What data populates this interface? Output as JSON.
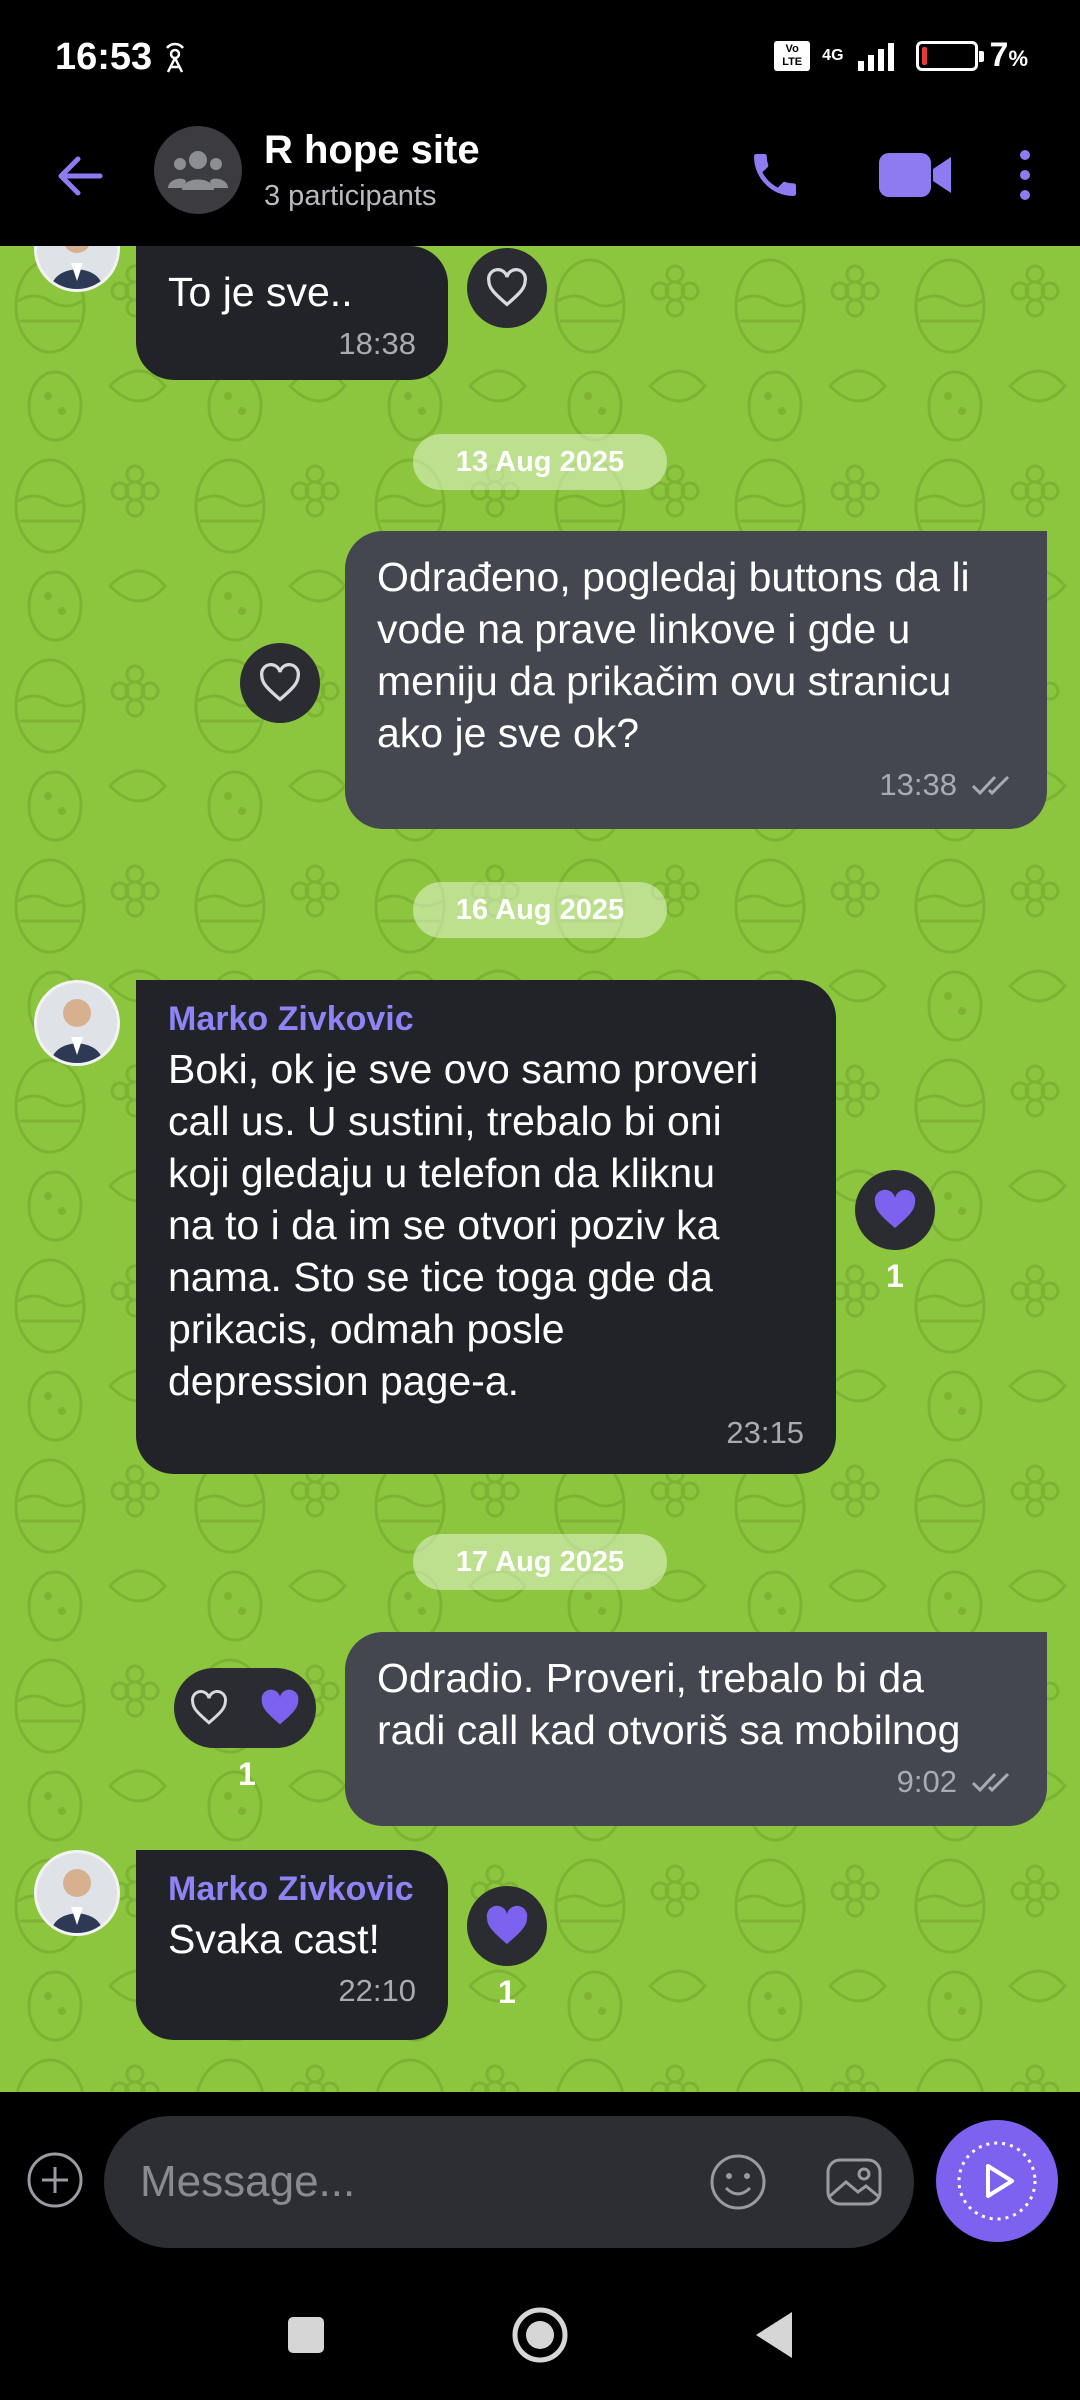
{
  "status_bar": {
    "time": "16:53",
    "volte": "Vo LTE",
    "network": "4G",
    "battery_percent": "7",
    "battery_unit": "%"
  },
  "header": {
    "title": "R hope site",
    "subtitle": "3 participants"
  },
  "colors": {
    "chat_background": "#8cc63e",
    "accent": "#7d62f0",
    "incoming_bubble": "#222328",
    "outgoing_bubble": "#444750"
  },
  "messages": [
    {
      "type": "in",
      "text": "To je sve..",
      "time": "18:38",
      "reaction": "heart-outline"
    },
    {
      "type": "date",
      "label": "13 Aug 2025"
    },
    {
      "type": "out",
      "text": "Odrađeno, pogledaj buttons da li\nvode na prave linkove i gde u\nmeniju da prikačim ovu stranicu\nako je sve ok?",
      "time": "13:38",
      "status": "read",
      "reaction": "heart-outline"
    },
    {
      "type": "date",
      "label": "16 Aug 2025"
    },
    {
      "type": "in",
      "sender": "Marko Zivkovic",
      "text": "Boki, ok je sve ovo samo proveri\ncall us. U sustini, trebalo bi oni\nkoji gledaju u telefon da kliknu\nna to i da im se otvori poziv ka\nnama. Sto se tice toga gde da\nprikacis, odmah posle\ndepression page-a.",
      "time": "23:15",
      "reaction": "heart-filled",
      "reaction_count": "1"
    },
    {
      "type": "date",
      "label": "17 Aug 2025"
    },
    {
      "type": "out",
      "text": "Odradio. Proveri, trebalo bi da\nradi call kad otvoriš sa mobilnog",
      "time": "9:02",
      "status": "read",
      "reaction": "heart-filled",
      "reaction_count": "1"
    },
    {
      "type": "in",
      "sender": "Marko Zivkovic",
      "text": "Svaka cast!",
      "time": "22:10",
      "reaction": "heart-filled",
      "reaction_count": "1"
    }
  ],
  "composer": {
    "placeholder": "Message..."
  },
  "icons": {
    "back": "arrow-left-icon",
    "call": "phone-icon",
    "video": "video-camera-icon",
    "more": "more-vertical-icon",
    "attach": "plus-circle-icon",
    "emoji": "smiley-icon",
    "gallery": "image-icon",
    "send": "send-icon"
  }
}
